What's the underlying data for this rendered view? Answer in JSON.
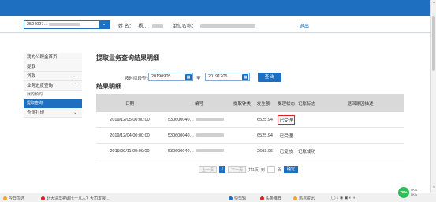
{
  "header": {
    "account_value": "2504027…",
    "name_label": "姓  名：",
    "name_value": "杨…",
    "unit_label": "单位名称：",
    "logout": "退出"
  },
  "sidebar": {
    "items": [
      {
        "label": "我的公积金首页",
        "chevron": false
      },
      {
        "label": "提取",
        "chevron": false
      },
      {
        "label": "贷款",
        "chevron": true
      },
      {
        "label": "业务进度查询",
        "chevron": true
      }
    ],
    "sub_items": [
      {
        "label": "我的预约",
        "active": false
      },
      {
        "label": "提取查询",
        "active": true
      }
    ],
    "last_item": {
      "label": "查询打印",
      "chevron": true
    }
  },
  "main": {
    "title": "提取业务查询结果明细",
    "query_label": "按时间段查询",
    "start_date": "20190905",
    "to_label": "至",
    "end_date": "20191205",
    "query_button": "查  询",
    "section_title": "结果明细"
  },
  "table": {
    "headers": [
      "日期",
      "编号",
      "提取钟类",
      "发生额",
      "受理状态",
      "记账标志",
      "退回原因描述"
    ],
    "rows": [
      {
        "date": "2019/12/05 00:00:00",
        "no": "530600040…",
        "fee": "",
        "amount": "6525.94",
        "status": "已受理",
        "flag": "",
        "reason": "",
        "highlight": true
      },
      {
        "date": "2019/12/04 00:00:00",
        "no": "530600040…",
        "fee": "",
        "amount": "6525.94",
        "status": "已受理",
        "flag": "",
        "reason": "",
        "highlight": false
      },
      {
        "date": "2019/09/11 00:00:00",
        "no": "530600040…",
        "fee": "",
        "amount": "2603.06",
        "status": "已复核",
        "flag": "记账成功",
        "reason": "",
        "highlight": false
      }
    ]
  },
  "pager": {
    "prev": "上一页",
    "current": "1",
    "next": "下一页",
    "total": "共1页",
    "goto": "到",
    "page_unit": "页",
    "confirm": "确定"
  },
  "taskbar": {
    "left_text": "今日优选",
    "news": "北大清华被碾压十几人？大司发展...",
    "items": [
      "快剪辑",
      "头条推荐",
      "热点资讯"
    ],
    "speed": "76%",
    "net_up": "0K/s",
    "net_down": "0K/s"
  },
  "colors": {
    "brand": "#1f6fc0",
    "highlight": "#e02020"
  }
}
